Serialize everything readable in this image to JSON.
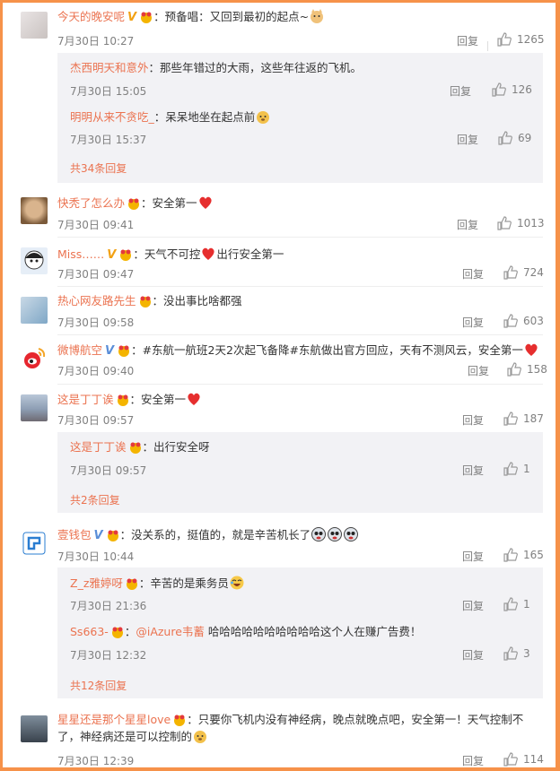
{
  "reply_label": "回复",
  "comments": [
    {
      "name": "今天的晚安呢",
      "text": "：预备唱：又回到最初的起点~",
      "time": "7月30日 10:27",
      "likes": "1265"
    },
    {
      "name": "快秃了怎么办",
      "text": "：安全第一",
      "time": "7月30日 09:41",
      "likes": "1013"
    },
    {
      "name": "Miss……",
      "text": "：天气不可控",
      "text2": "出行安全第一",
      "time": "7月30日 09:47",
      "likes": "724"
    },
    {
      "name": "热心网友路先生",
      "text": "：没出事比啥都强",
      "time": "7月30日 09:58",
      "likes": "603"
    },
    {
      "name": "微博航空",
      "text": "：#东航一航班2天2次起飞备降#东航做出官方回应，天有不测风云，安全第一",
      "time": "7月30日 09:40",
      "likes": "158"
    },
    {
      "name": "这是丁丁诶",
      "text": "：安全第一",
      "time": "7月30日 09:57",
      "likes": "187"
    },
    {
      "name": "壹钱包",
      "text": "：没关系的，挺值的，就是辛苦机长了",
      "time": "7月30日 10:44",
      "likes": "165"
    },
    {
      "name": "星星还是那个星星love",
      "text": "：只要你飞机内没有神经病，晚点就晚点吧，安全第一！天气控制不了，神经病还是可以控制的",
      "time": "7月30日 12:39",
      "likes": "114"
    }
  ],
  "replies": [
    {
      "name": "杰西明天和意外",
      "text": "：那些年错过的大雨，这些年往返的飞机。",
      "time": "7月30日 15:05",
      "likes": "126"
    },
    {
      "name": "明明从来不贪吃_",
      "text": "：呆呆地坐在起点前",
      "time": "7月30日 15:37",
      "likes": "69"
    },
    {
      "name": "这是丁丁诶",
      "text": "：出行安全呀",
      "time": "7月30日 09:57",
      "likes": "1"
    },
    {
      "name": "Z_z雅婷呀",
      "text": "：辛苦的是乘务员",
      "time": "7月30日 21:36",
      "likes": "1"
    },
    {
      "name": "Ss663-",
      "text": "：",
      "mention": "@iAzure韦蓄",
      "text2": " 哈哈哈哈哈哈哈哈哈哈这个人在赚广告费！",
      "time": "7月30日 12:32",
      "likes": "3"
    }
  ],
  "more_links": [
    "共34条回复",
    "共2条回复",
    "共12条回复"
  ],
  "colors": {
    "accent": "#eb7350",
    "border": "#f6924a",
    "subbg": "#f2f2f5",
    "muted": "#808080"
  }
}
